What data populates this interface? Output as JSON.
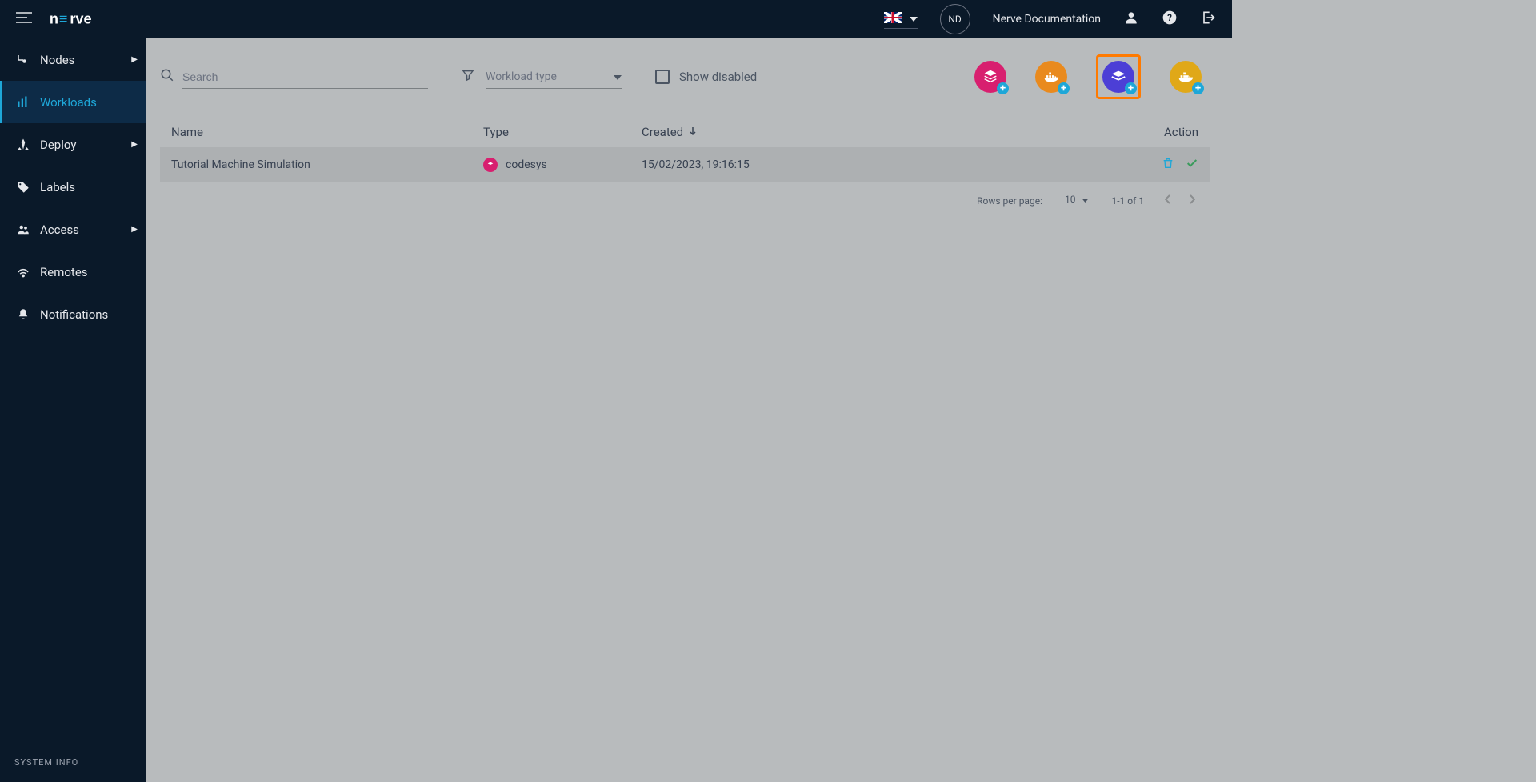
{
  "header": {
    "avatar_initials": "ND",
    "documentation_label": "Nerve Documentation"
  },
  "sidebar": {
    "items": [
      {
        "label": "Nodes"
      },
      {
        "label": "Workloads"
      },
      {
        "label": "Deploy"
      },
      {
        "label": "Labels"
      },
      {
        "label": "Access"
      },
      {
        "label": "Remotes"
      },
      {
        "label": "Notifications"
      }
    ],
    "system_info": "SYSTEM INFO"
  },
  "toolbar": {
    "search_placeholder": "Search",
    "workload_type_placeholder": "Workload type",
    "show_disabled_label": "Show disabled"
  },
  "table": {
    "headers": {
      "name": "Name",
      "type": "Type",
      "created": "Created",
      "action": "Action"
    },
    "rows": [
      {
        "name": "Tutorial Machine Simulation",
        "type": "codesys",
        "created": "15/02/2023, 19:16:15"
      }
    ]
  },
  "pagination": {
    "rows_label": "Rows per page:",
    "rows_value": "10",
    "range": "1-1 of 1"
  }
}
